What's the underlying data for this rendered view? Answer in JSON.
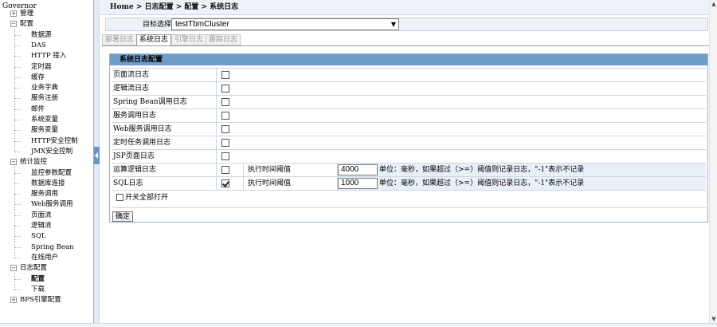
{
  "tree": {
    "root": "Governor",
    "items": [
      {
        "label": "管理",
        "box": "+"
      },
      {
        "label": "配置",
        "box": "-"
      },
      {
        "label": "数据源"
      },
      {
        "label": "DAS"
      },
      {
        "label": "HTTP 接入"
      },
      {
        "label": "定时器"
      },
      {
        "label": "缓存"
      },
      {
        "label": "业务字典"
      },
      {
        "label": "服务注册"
      },
      {
        "label": "邮件"
      },
      {
        "label": "系统变量"
      },
      {
        "label": "服务变量"
      },
      {
        "label": "HTTP安全控制"
      },
      {
        "label": "JMX安全控制"
      },
      {
        "label": "统计监控",
        "box": "-"
      },
      {
        "label": "监控参数配置"
      },
      {
        "label": "数据库连接"
      },
      {
        "label": "服务调用"
      },
      {
        "label": "Web服务调用"
      },
      {
        "label": "页面流"
      },
      {
        "label": "逻辑流"
      },
      {
        "label": "SQL"
      },
      {
        "label": "Spring Bean"
      },
      {
        "label": "在线用户"
      },
      {
        "label": "日志配置",
        "box": "-"
      },
      {
        "label": "配置"
      },
      {
        "label": "下载"
      },
      {
        "label": "BPS引擎配置",
        "box": "+"
      }
    ]
  },
  "breadcrumb": "Home > 日志配置 > 配置 > 系统日志",
  "target": {
    "label": "目标选择:",
    "value": "testTbmCluster"
  },
  "tabs": [
    "部署日志",
    "系统日志",
    "引擎日志",
    "跟踪日志"
  ],
  "panel": {
    "title": "系统日志配置",
    "rows": [
      {
        "label": "页面流日志",
        "checked": false
      },
      {
        "label": "逻辑流日志",
        "checked": false
      },
      {
        "label": "Spring Bean调用日志",
        "checked": false
      },
      {
        "label": "服务调用日志",
        "checked": false
      },
      {
        "label": "Web服务调用日志",
        "checked": false
      },
      {
        "label": "定时任务调用日志",
        "checked": false
      },
      {
        "label": "JSP页面日志",
        "checked": false
      },
      {
        "label": "运算逻辑日志",
        "checked": false,
        "threshold_label": "执行时间阈值",
        "threshold": "4000",
        "note": "单位：毫秒，如果超过（>=）阈值则记录日志，\"-1\"表示不记录"
      },
      {
        "label": "SQL日志",
        "checked": true,
        "threshold_label": "执行时间阈值",
        "threshold": "1000",
        "note": "单位：毫秒，如果超过（>=）阈值则记录日志，\"-1\"表示不记录"
      }
    ],
    "toggle_all_label": "开关全部打开",
    "toggle_all_checked": false,
    "confirm_label": "确定"
  },
  "colors": {
    "header_bar": "#6f9cc9",
    "border": "#8fb4d8"
  }
}
